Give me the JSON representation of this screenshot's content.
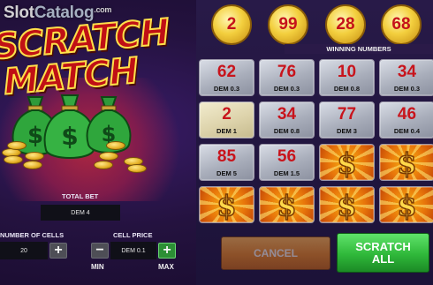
{
  "watermark": {
    "part1": "Slot",
    "part2": "Catalog",
    "suffix": ".com"
  },
  "logo": {
    "line1": "SCRATCH",
    "line2": "MATCH"
  },
  "winning_numbers": {
    "label": "WINNING NUMBERS",
    "values": [
      "2",
      "99",
      "28",
      "68"
    ]
  },
  "grid": [
    {
      "number": "62",
      "prize": "DEM 0.3",
      "state": "revealed"
    },
    {
      "number": "76",
      "prize": "DEM 0.3",
      "state": "revealed"
    },
    {
      "number": "10",
      "prize": "DEM 0.8",
      "state": "revealed"
    },
    {
      "number": "34",
      "prize": "DEM 0.3",
      "state": "revealed"
    },
    {
      "number": "2",
      "prize": "DEM 1",
      "state": "revealed-match"
    },
    {
      "number": "34",
      "prize": "DEM 0.8",
      "state": "revealed"
    },
    {
      "number": "77",
      "prize": "DEM 3",
      "state": "revealed"
    },
    {
      "number": "46",
      "prize": "DEM 0.4",
      "state": "revealed"
    },
    {
      "number": "85",
      "prize": "DEM 5",
      "state": "revealed"
    },
    {
      "number": "56",
      "prize": "DEM 1.5",
      "state": "revealed"
    },
    {
      "number": "",
      "prize": "",
      "state": "hidden"
    },
    {
      "number": "",
      "prize": "",
      "state": "hidden"
    },
    {
      "number": "",
      "prize": "",
      "state": "hidden"
    },
    {
      "number": "",
      "prize": "",
      "state": "hidden"
    },
    {
      "number": "",
      "prize": "",
      "state": "hidden"
    },
    {
      "number": "",
      "prize": "",
      "state": "hidden"
    }
  ],
  "hidden_symbol": "$",
  "bet": {
    "total_bet_label": "TOTAL BET",
    "total_bet_value": "DEM 4",
    "cells_label": "NUMBER OF CELLS",
    "cells_value": "20",
    "cell_price_label": "CELL PRICE",
    "cell_price_value": "DEM 0.1",
    "min_label": "MIN",
    "max_label": "MAX",
    "minus": "−",
    "plus": "+"
  },
  "buttons": {
    "cancel": "CANCEL",
    "scratch_line1": "SCRATCH",
    "scratch_line2": "ALL"
  },
  "colors": {
    "number_red": "#c8141c",
    "scratch_green": "#2fb83a",
    "cancel_orange": "#e8841c",
    "gold": "#f3cf3e"
  },
  "icons": [
    "money-bag-icon",
    "gold-coin-icon",
    "dollar-icon",
    "plus-icon",
    "minus-icon"
  ]
}
